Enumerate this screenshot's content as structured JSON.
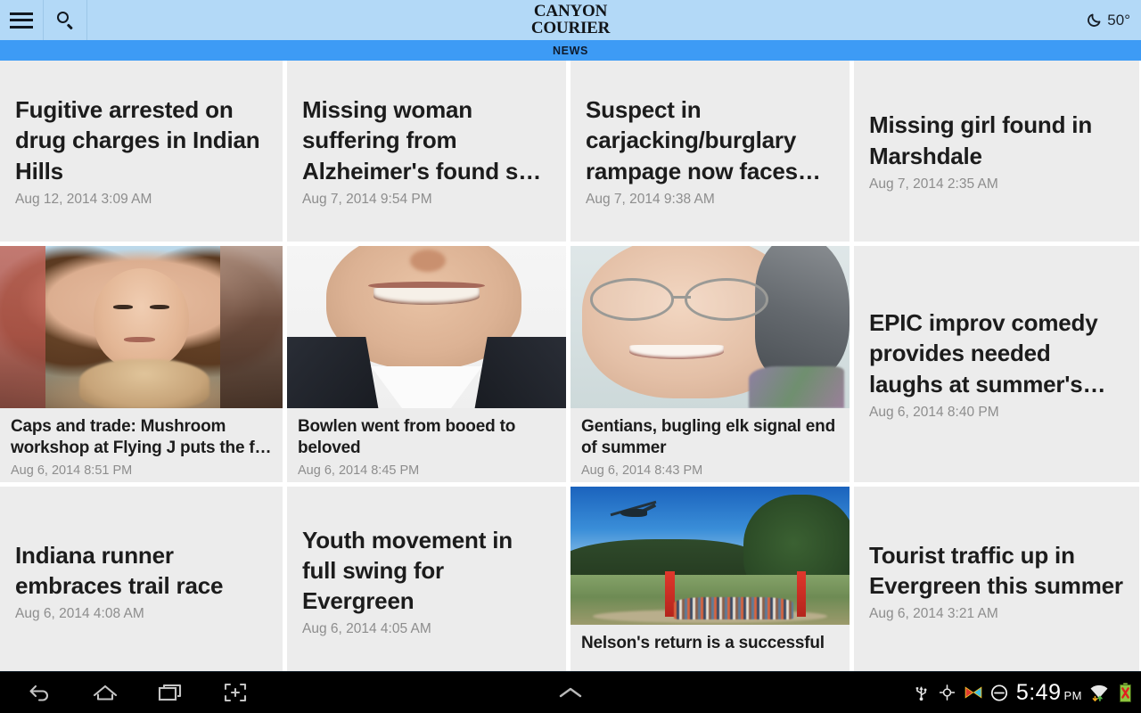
{
  "header": {
    "menu_icon": "hamburger-menu-icon",
    "search_icon": "search-icon",
    "brand_line1": "CANYON",
    "brand_line2": "COURIER",
    "weather_icon": "crescent-moon-icon",
    "temperature": "50°",
    "background_color": "#b3d9f7"
  },
  "tabbar": {
    "background_color": "#3d9bf5",
    "tabs": [
      {
        "label": "NEWS",
        "active": true
      }
    ]
  },
  "grid": {
    "rows": [
      {
        "cards": [
          {
            "headline": "Fugitive arrested on drug charges in Indian Hills",
            "timestamp": "Aug 12, 2014 3:09 AM",
            "image": null
          },
          {
            "headline": "Missing woman suffering from Alzheimer's found s…",
            "timestamp": "Aug 7, 2014 9:54 PM",
            "image": null
          },
          {
            "headline": "Suspect in carjacking/burglary rampage now faces…",
            "timestamp": "Aug 7, 2014 9:38 AM",
            "image": null
          },
          {
            "headline": "Missing girl found in Marshdale",
            "timestamp": "Aug 7, 2014 2:35 AM",
            "image": null
          }
        ]
      },
      {
        "cards": [
          {
            "headline": "Caps and trade: Mushroom workshop at Flying J puts the f…",
            "timestamp": "Aug 6, 2014 8:51 PM",
            "image": "photo-young-girl-with-puppy"
          },
          {
            "headline": "Bowlen went from booed to beloved",
            "timestamp": "Aug 6, 2014 8:45 PM",
            "image": "photo-smiling-man-in-suit"
          },
          {
            "headline": "Gentians, bugling elk signal end of summer",
            "timestamp": "Aug 6, 2014 8:43 PM",
            "image": "photo-elderly-woman-with-glasses"
          },
          {
            "headline": "EPIC improv comedy provides needed laughs at summer's…",
            "timestamp": "Aug 6, 2014 8:40 PM",
            "image": null
          }
        ]
      },
      {
        "cards": [
          {
            "headline": "Indiana runner embraces trail race",
            "timestamp": "Aug 6, 2014 4:08 AM",
            "image": null
          },
          {
            "headline": "Youth movement in full swing for Evergreen",
            "timestamp": "Aug 6, 2014 4:05 AM",
            "image": null
          },
          {
            "headline": "Nelson's return is a successful",
            "timestamp": "",
            "image": "photo-trail-race-with-helicopter"
          },
          {
            "headline": "Tourist traffic up in Evergreen this summer",
            "timestamp": "Aug 6, 2014 3:21 AM",
            "image": null
          }
        ]
      }
    ]
  },
  "navbar": {
    "background_color": "#000000",
    "buttons": [
      {
        "icon": "back-arrow-icon"
      },
      {
        "icon": "home-icon"
      },
      {
        "icon": "recent-apps-icon"
      },
      {
        "icon": "screenshot-icon"
      }
    ],
    "center_icon": "chevron-up-icon",
    "status_icons": [
      "usb-icon",
      "gps-location-icon",
      "screen-cast-icon",
      "do-not-disturb-icon"
    ],
    "clock_time": "5:49",
    "clock_period": "PM",
    "trailing_icons": [
      "wifi-icon",
      "battery-error-icon"
    ]
  }
}
